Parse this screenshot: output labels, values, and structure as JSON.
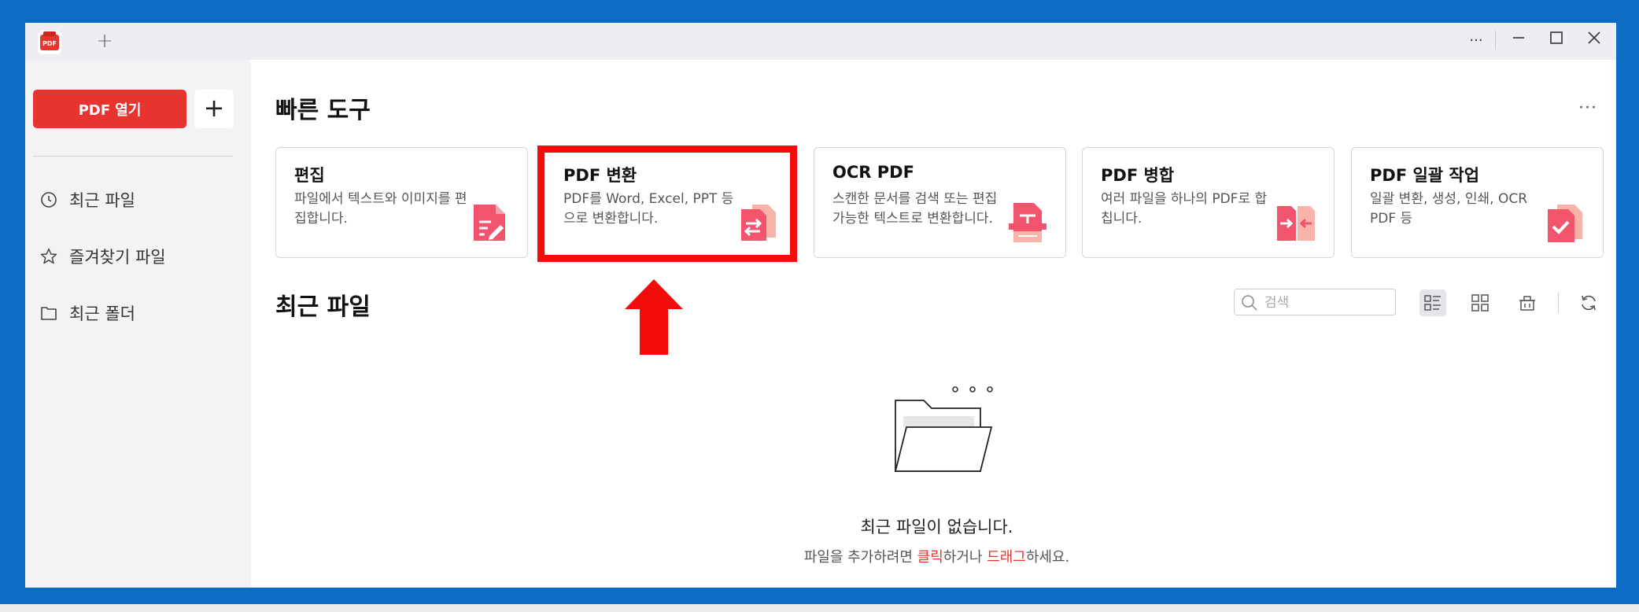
{
  "titlebar": {
    "new_tab_label": "+",
    "more_label": "···",
    "minimize_label": "—",
    "close_label": "✕",
    "logo_text": "PDF"
  },
  "sidebar": {
    "open_pdf_label": "PDF 열기",
    "add_label": "+",
    "items": [
      {
        "label": "최근 파일",
        "icon": "clock-icon"
      },
      {
        "label": "즐겨찾기 파일",
        "icon": "star-icon"
      },
      {
        "label": "최근 폴더",
        "icon": "folder-icon"
      }
    ]
  },
  "quick_tools": {
    "title": "빠른 도구",
    "more_label": "···",
    "cards": [
      {
        "title": "편집",
        "desc": "파일에서 텍스트와 이미지를 편집합니다.",
        "icon": "edit-doc-icon"
      },
      {
        "title": "PDF 변환",
        "desc": "PDF를 Word, Excel, PPT 등으로 변환합니다.",
        "icon": "convert-doc-icon"
      },
      {
        "title": "OCR PDF",
        "desc": "스캔한 문서를 검색 또는 편집 가능한 텍스트로 변환합니다.",
        "icon": "scan-doc-icon"
      },
      {
        "title": "PDF 병합",
        "desc": "여러 파일을 하나의 PDF로 합칩니다.",
        "icon": "merge-doc-icon"
      },
      {
        "title": "PDF 일괄 작업",
        "desc": "일괄 변환, 생성, 인쇄, OCR PDF 등",
        "icon": "batch-doc-icon"
      }
    ]
  },
  "recent": {
    "title": "최근 파일",
    "search_placeholder": "검색",
    "empty_title": "최근 파일이 없습니다.",
    "empty_sub_1": "파일을 추가하려면 ",
    "empty_sub_click": "클릭",
    "empty_sub_2": "하거나 ",
    "empty_sub_drag": "드래그",
    "empty_sub_3": "하세요."
  },
  "colors": {
    "accent": "#e8342f",
    "frame": "#0a6cc2",
    "highlight": "#f40b0b",
    "icon_pink": "#f2536d"
  }
}
